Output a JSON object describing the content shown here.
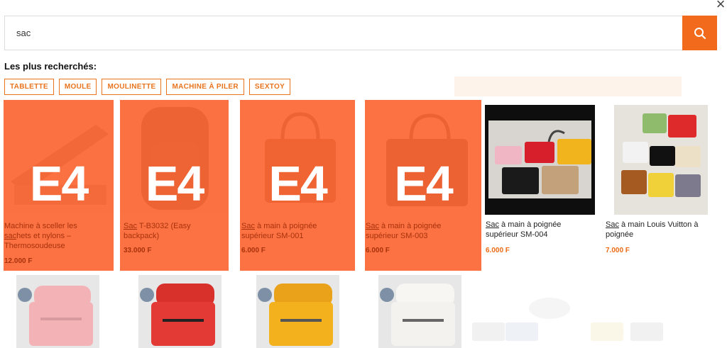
{
  "search": {
    "value": "sac",
    "icon": "search-icon"
  },
  "close": {
    "symbol": "×"
  },
  "popular": {
    "title": "Les plus recherchés:",
    "tags": [
      "TABLETTE",
      "MOULE",
      "MOULINETTE",
      "MACHINE À PILER",
      "SEXTOY"
    ]
  },
  "overlay_label": "E4",
  "products": [
    {
      "title_lines": [
        "Machine à sceller les",
        "sachets et nylons –",
        "Thermosoudeuse"
      ],
      "highlight": "sac",
      "price": "12.000 F",
      "dimmed": true
    },
    {
      "title_lines": [
        "T-B3032 (Easy",
        "backpack)"
      ],
      "highlight": "Sac",
      "price": "33.000 F",
      "dimmed": true
    },
    {
      "title_lines": [
        "à main à poignée",
        "supérieur SM-001"
      ],
      "highlight": "Sac",
      "price": "6.000 F",
      "dimmed": true
    },
    {
      "title_lines": [
        "à main à poignée",
        "supérieur SM-003"
      ],
      "highlight": "Sac",
      "price": "6.000 F",
      "dimmed": true
    },
    {
      "title_lines": [
        "à main à poignée",
        "supérieur SM-004"
      ],
      "highlight": "Sac",
      "price": "6.000 F",
      "dimmed": false
    },
    {
      "title_lines": [
        "à main Louis Vuitton à",
        "poignée"
      ],
      "highlight": "Sac",
      "price": "7.000 F",
      "dimmed": false
    }
  ],
  "colors": {
    "accent": "#f26a1b",
    "overlay": "#fc6735",
    "price": "#ec6a15",
    "bag_pink": "#f2b2b6",
    "bag_red": "#e33a36",
    "bag_yellow": "#f2b11d",
    "bag_white": "#f4f2ee"
  }
}
